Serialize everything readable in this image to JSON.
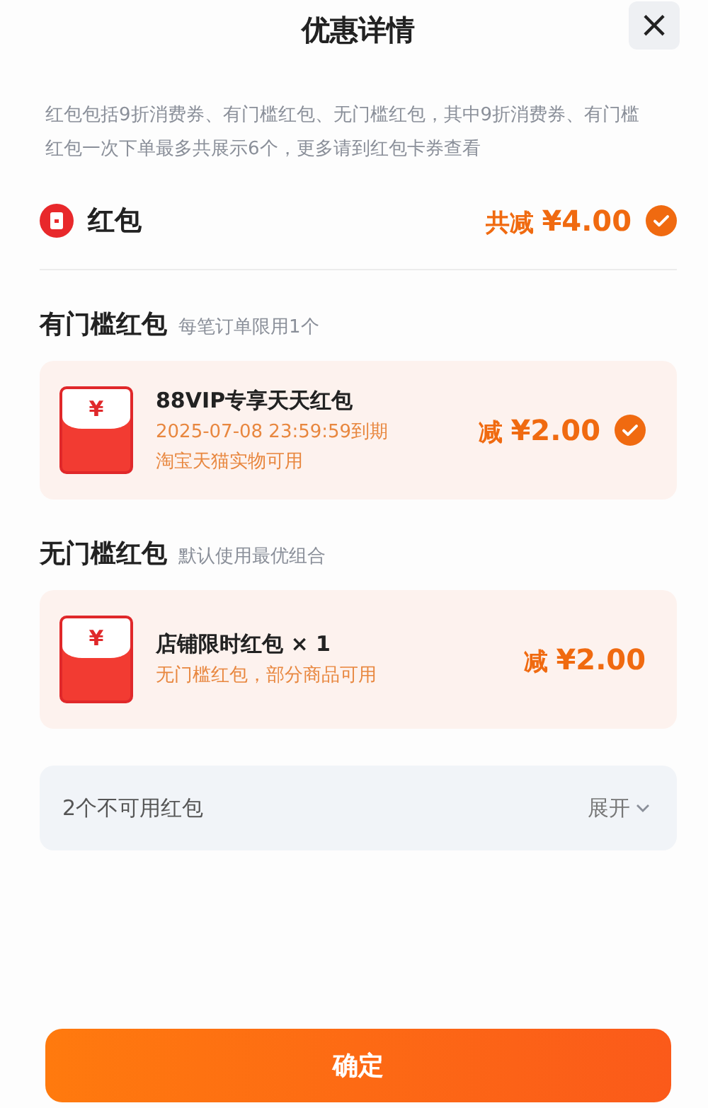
{
  "title": "优惠详情",
  "close_button": "×",
  "description": "红包包括9折消费券、有门槛红包、无门槛红包，其中9折消费券、有门槛红包一次下单最多共展示6个，更多请到红包卡券查看",
  "summary": {
    "label": "红包",
    "total_label": "共减",
    "total": "¥4.00",
    "checked": true
  },
  "sections": [
    {
      "heading": "有门槛红包",
      "note": "每笔订单限用1个",
      "items": [
        {
          "symbol": "¥",
          "name": "88VIP专享天天红包",
          "lines": [
            "2025-07-08 23:59:59到期",
            "淘宝天猫实物可用"
          ],
          "discount_label": "减",
          "discount": "¥2.00",
          "checked": true
        }
      ]
    },
    {
      "heading": "无门槛红包",
      "note": "默认使用最优组合",
      "items": [
        {
          "symbol": "¥",
          "name": "店铺限时红包 × 1",
          "lines": [
            "无门槛红包，部分商品可用"
          ],
          "discount_label": "减",
          "discount": "¥2.00",
          "checked": false
        }
      ]
    }
  ],
  "unavailable": {
    "label": "2个不可用红包",
    "toggle": "展开",
    "expanded": false
  },
  "confirm_button": "确定"
}
